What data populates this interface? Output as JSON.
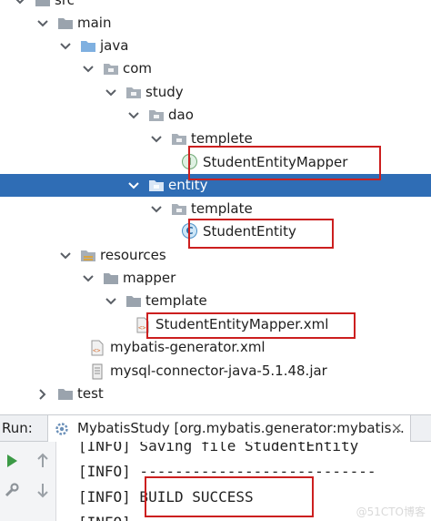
{
  "tree": {
    "items": [
      {
        "label": "src",
        "kind": "folder",
        "expanded": true
      },
      {
        "label": "main",
        "kind": "folder",
        "expanded": true
      },
      {
        "label": "java",
        "kind": "source-folder",
        "expanded": true
      },
      {
        "label": "com",
        "kind": "package",
        "expanded": true
      },
      {
        "label": "study",
        "kind": "package",
        "expanded": true
      },
      {
        "label": "dao",
        "kind": "package",
        "expanded": true
      },
      {
        "label": "templete",
        "kind": "package",
        "expanded": true
      },
      {
        "label": "StudentEntityMapper",
        "kind": "interface",
        "badge": "I"
      },
      {
        "label": "entity",
        "kind": "package",
        "expanded": true,
        "selected": true
      },
      {
        "label": "template",
        "kind": "package",
        "expanded": true
      },
      {
        "label": "StudentEntity",
        "kind": "class",
        "badge": "C"
      },
      {
        "label": "resources",
        "kind": "resources-folder",
        "expanded": true
      },
      {
        "label": "mapper",
        "kind": "folder",
        "expanded": true
      },
      {
        "label": "template",
        "kind": "folder",
        "expanded": true
      },
      {
        "label": "StudentEntityMapper.xml",
        "kind": "xml-file"
      },
      {
        "label": "mybatis-generator.xml",
        "kind": "xml-file"
      },
      {
        "label": "mysql-connector-java-5.1.48.jar",
        "kind": "jar-file"
      },
      {
        "label": "test",
        "kind": "folder",
        "expanded": false
      }
    ]
  },
  "run": {
    "label": "Run:",
    "tab_title": "MybatisStudy [org.mybatis.generator:mybatis...",
    "close": "×"
  },
  "console": {
    "lines": [
      "[INFO] Saving file StudentEntity",
      "[INFO] ---------------------------",
      "[INFO] BUILD SUCCESS",
      "[INFO] ---------------------------"
    ]
  },
  "watermark": "@51CTO博客",
  "colors": {
    "selection": "#2f6db5",
    "highlight_box": "#cc1f1f",
    "run_green": "#3c9a46"
  }
}
